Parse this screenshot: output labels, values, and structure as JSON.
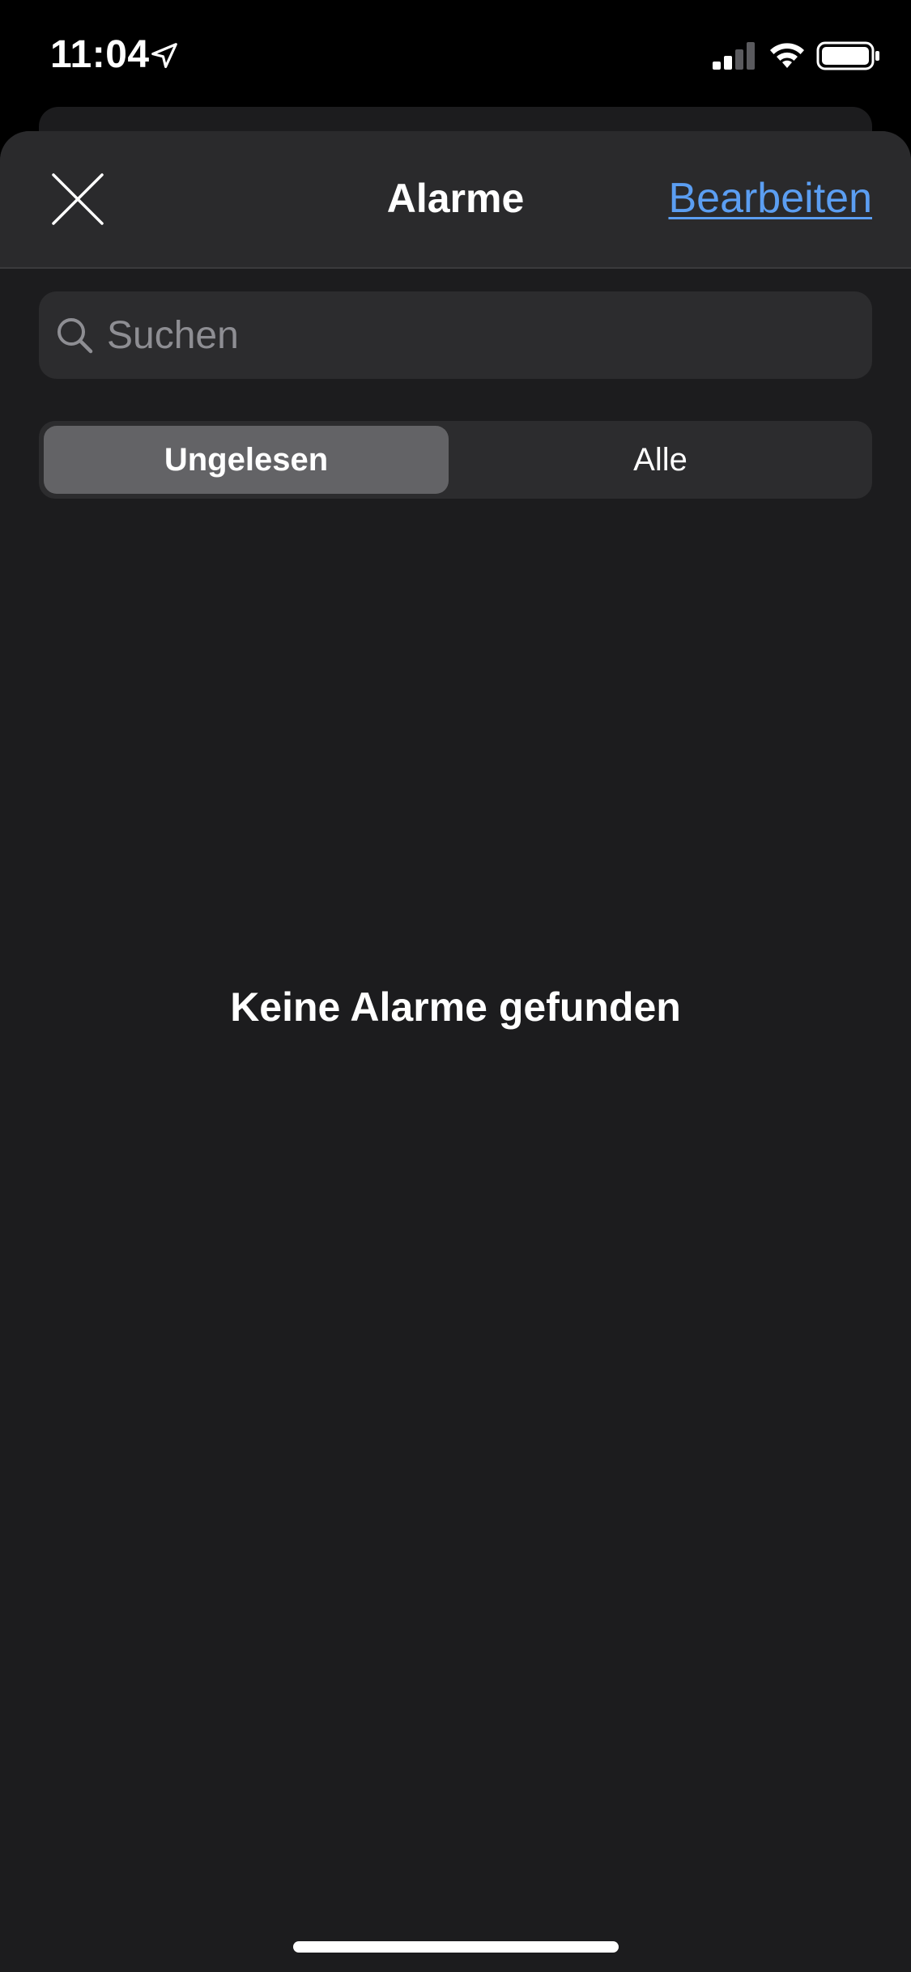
{
  "status_bar": {
    "time": "11:04",
    "icons": [
      "location-arrow-icon",
      "cellular-signal-icon",
      "wifi-icon",
      "battery-icon"
    ]
  },
  "nav": {
    "close_icon": "close-icon",
    "title": "Alarme",
    "edit_label": "Bearbeiten"
  },
  "search": {
    "icon": "search-icon",
    "placeholder": "Suchen",
    "value": ""
  },
  "segments": {
    "items": [
      {
        "label": "Ungelesen",
        "selected": true
      },
      {
        "label": "Alle",
        "selected": false
      }
    ]
  },
  "empty_state": {
    "message": "Keine Alarme gefunden"
  },
  "colors": {
    "background": "#000000",
    "sheet": "#1c1c1e",
    "nav_bar": "#2a2a2c",
    "accent": "#5b9ef2",
    "segment_selected": "#636366",
    "field": "#2c2c2e"
  }
}
